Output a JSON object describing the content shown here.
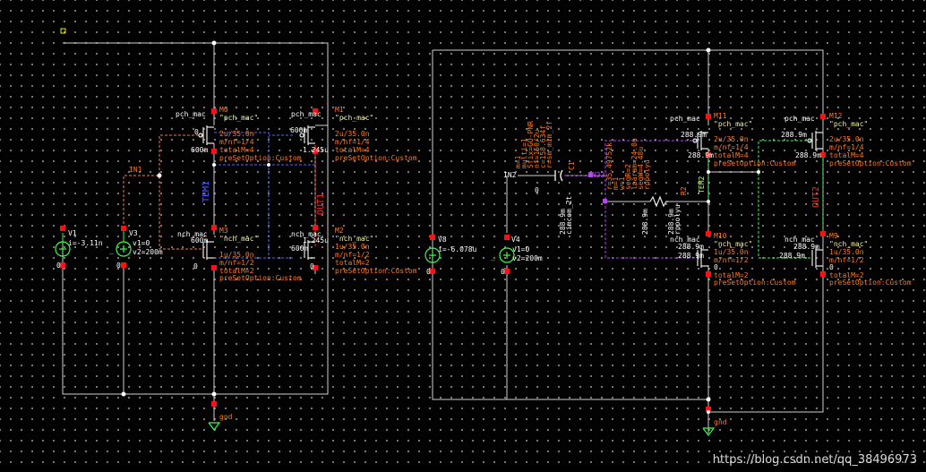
{
  "colors": {
    "background": "#000000",
    "wire": "#d9d9d9",
    "net_in1": "#ff7a3a",
    "net_out1": "#ff3a20",
    "net_blue": "#5566ff",
    "net_purple": "#c040ff",
    "net_green": "#3aff4a",
    "device": "#ffffff",
    "label_orange": "#ff7a20",
    "pin_red": "#ff1010"
  },
  "left_circuit": {
    "sources": {
      "v1_name": "V1",
      "v1_value": "i=-3.11n",
      "v3_name": "V3",
      "v3_v1": "v1=0",
      "v3_v2": "v2=200m",
      "v3_prefix": "_",
      "ground_v1": "0",
      "ground_v3": "0"
    },
    "nets": {
      "in": "IN1",
      "out": "OUT1",
      "mid": "TEM1",
      "gnd": "gnd"
    },
    "m0": {
      "model": "pch_mac",
      "name": "M0",
      "quoted": "\"pch_mac\"",
      "w_l": "2u/35.0n",
      "mnf": "m/nf=1/4",
      "total": "totalM=4",
      "preset": "preSetOption:Custom",
      "v_a": "0",
      "v_b": "600m"
    },
    "m1": {
      "model": "pch_mac",
      "name": "M1",
      "quoted": "\"pch_mac\"",
      "w_l": "2u/35.0n",
      "mnf": "m/nf=1/4",
      "total": "totalM=4",
      "preset": "preSetOption:Custom",
      "v_a": "600m",
      "v_b": "1.245u"
    },
    "m3": {
      "model": "nch_mac",
      "name": "M3",
      "quoted": "\"nch_mac\"",
      "w_l": "1u/35.0n",
      "mnf": "m/nf=1/2",
      "total": "totalM=2",
      "preset": "preSetOption:Custom",
      "v_a": "600m",
      "v_b": "0"
    },
    "m2": {
      "model": "nch_mac",
      "name": "M2",
      "quoted": "\"nch_mac\"",
      "w_l": "1u/35.0n",
      "mnf": "m/nf=1/2",
      "total": "totalM=2",
      "preset": "preSetOption:Custom",
      "v_a": "1.245u",
      "v_b": "600m",
      "v_c": "0"
    }
  },
  "right_circuit": {
    "sources": {
      "v8_name": "V8",
      "v8_value": "i=-6.078u",
      "v4_name": "V4",
      "v4_v1": "v1=0",
      "v4_v2": "v2=200m",
      "v4_prefix": "_",
      "ground_v8": "0",
      "ground_v4": "0"
    },
    "nets": {
      "in": "IN2",
      "out": "OUT2",
      "mid": "TEM2",
      "node": "IN22",
      "gnd": "gnd"
    },
    "cap": {
      "name": "C1",
      "lines": [
        "m=1",
        "multi=1",
        "Sfix=GO-PNR",
        "nf=150/2u",
        "c=158.634f",
        "r=sm_mim_2f"
      ],
      "v_a": "0",
      "v_b": "288.9m",
      "extra": "cimcom_2t"
    },
    "res": {
      "name": "R2",
      "lines": [
        "r=35.49752k",
        "m=1",
        "w=1",
        "segR=2",
        "lparam=24.0u",
        "segW=4.48u",
        "rppolyu"
      ],
      "v_a": "288.9m",
      "v_b": "288.9m",
      "extra": "rppolyu"
    },
    "m11": {
      "model": "pch_mac",
      "name": "M11",
      "quoted": "\"pch_mac\"",
      "w_l": "2u/35.0n",
      "mnf": "m/nf=1/4",
      "total": "totalM=4",
      "preset": "preSetOption:Custom",
      "v_a": "288.9m",
      "v_b": "288.9m"
    },
    "m12": {
      "model": "pch_mac",
      "name": "M12",
      "quoted": "\"pch_mac\"",
      "w_l": "2u/35.0n",
      "mnf": "m/nf=1/4",
      "total": "totalM=4",
      "preset": "preSetOption:Custom",
      "v_a": "288.9m",
      "v_b": "288.9m"
    },
    "m10": {
      "model": "nch_mac",
      "name": "M10",
      "quoted": "\"nch_mac\"",
      "w_l": "1u/35.0n",
      "mnf": "m/nf=1/2",
      "total": "totalM=2",
      "preset": "preSetOption:Custom",
      "v_a": "288.9m",
      "v_b": "288.9m",
      "v_c": "0"
    },
    "m9": {
      "model": "nch_mac",
      "name": "M9",
      "quoted": "\"nch_mac\"",
      "w_l": "1u/35.0n",
      "mnf": "m/nf=1/2",
      "total": "totalM=2",
      "preset": "preSetOption:Custom",
      "v_a": "288.9m",
      "v_b": "288.9m",
      "v_c": "0"
    }
  },
  "watermark": "https://blog.csdn.net/qq_38496973"
}
